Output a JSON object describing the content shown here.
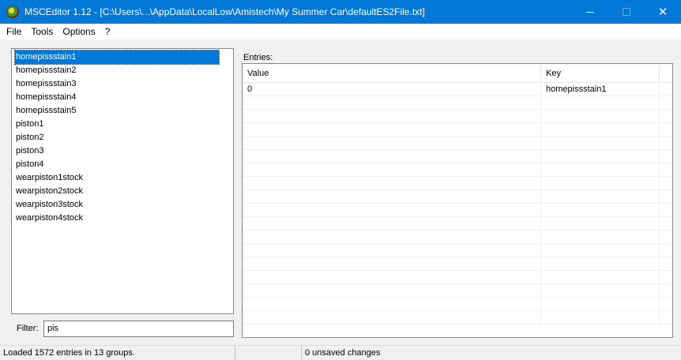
{
  "window": {
    "title": "MSCEditor 1.12 - [C:\\Users\\...\\AppData\\LocalLow\\Amistech\\My Summer Car\\defaultES2File.txt]",
    "icon": "app-icon",
    "controls": {
      "minimize": "minimize-icon",
      "maximize": "maximize-icon",
      "close": "close-icon",
      "close_glyph": "✕"
    },
    "accent": "#0078d7"
  },
  "menu": {
    "items": [
      "File",
      "Tools",
      "Options",
      "?"
    ]
  },
  "groups": {
    "items": [
      "homepissstain1",
      "homepissstain2",
      "homepissstain3",
      "homepissstain4",
      "homepissstain5",
      "piston1",
      "piston2",
      "piston3",
      "piston4",
      "wearpiston1stock",
      "wearpiston2stock",
      "wearpiston3stock",
      "wearpiston4stock"
    ],
    "selected_index": 0
  },
  "filter": {
    "label": "Filter:",
    "value": "pis"
  },
  "entries": {
    "label": "Entries:",
    "columns": [
      "Value",
      "Key"
    ],
    "rows": [
      [
        "0",
        "homepissstain1"
      ]
    ],
    "empty_row_count": 17
  },
  "status": {
    "loaded": "Loaded 1572 entries in 13 groups.",
    "middle": "",
    "unsaved": "0 unsaved changes"
  }
}
